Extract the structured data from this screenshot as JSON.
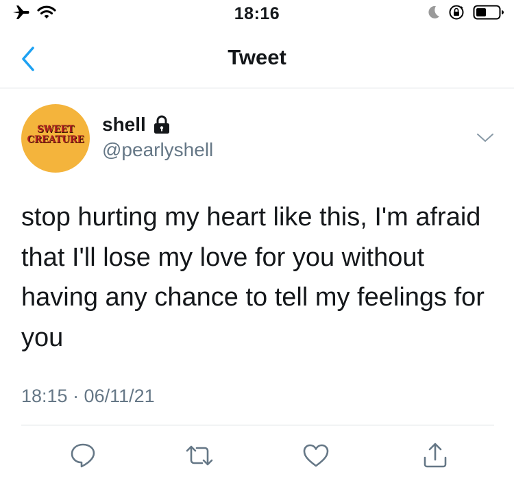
{
  "status_bar": {
    "time": "18:16",
    "icons_left": [
      "airplane-icon",
      "wifi-icon"
    ],
    "icons_right": [
      "moon-icon",
      "orientation-lock-icon",
      "battery-icon"
    ]
  },
  "nav": {
    "title": "Tweet",
    "back_icon": "chevron-left-icon"
  },
  "tweet": {
    "author": {
      "display_name": "shell",
      "handle": "@pearlyshell",
      "protected_icon": "lock-icon",
      "avatar_text": [
        "SWEET",
        "CREATURE"
      ]
    },
    "text": "stop hurting my heart like this, I'm afraid that I'll lose my love for you without having any chance to tell my feelings for you",
    "timestamp": "18:15 · 06/11/21",
    "more_icon": "chevron-down-icon",
    "actions": [
      "reply-icon",
      "retweet-icon",
      "like-icon",
      "share-icon"
    ]
  },
  "colors": {
    "accent": "#1da1f2",
    "secondary_text": "#657786",
    "icon_gray": "#657786",
    "avatar_bg": "#f4b43c",
    "avatar_text": "#b12020"
  }
}
